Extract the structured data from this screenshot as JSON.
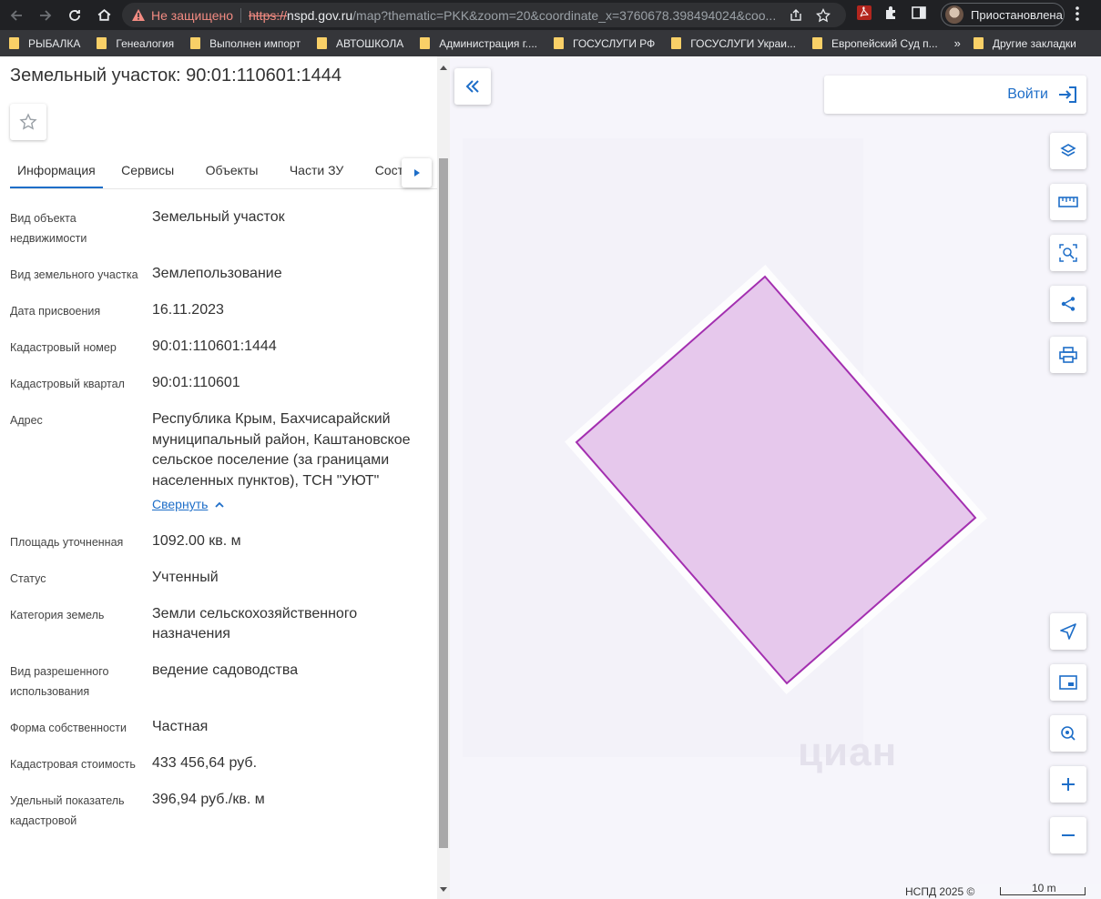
{
  "browser": {
    "security_label": "Не защищено",
    "url_scheme": "https://",
    "url_host": "nspd.gov.ru",
    "url_rest": "/map?thematic=PKK&zoom=20&coordinate_x=3760678.398494024&coo...",
    "profile_label": "Приостановлена"
  },
  "bookmarks": {
    "items": [
      "РЫБАЛКА",
      "Генеалогия",
      "Выполнен импорт",
      "АВТОШКОЛА",
      "Администрация г....",
      "ГОСУСЛУГИ РФ",
      "ГОСУСЛУГИ Украи...",
      "Европейский Суд п..."
    ],
    "more": "»",
    "other": "Другие закладки"
  },
  "panel": {
    "title": "Земельный участок: 90:01:110601:1444",
    "tabs": [
      "Информация",
      "Сервисы",
      "Объекты",
      "Части ЗУ",
      "Соста..."
    ],
    "rows": [
      {
        "label": "Вид объекта недвижимости",
        "value": "Земельный участок"
      },
      {
        "label": "Вид земельного участка",
        "value": "Землепользование"
      },
      {
        "label": "Дата присвоения",
        "value": "16.11.2023"
      },
      {
        "label": "Кадастровый номер",
        "value": "90:01:110601:1444"
      },
      {
        "label": "Кадастровый квартал",
        "value": "90:01:110601"
      },
      {
        "label": "Адрес",
        "value": "Республика Крым, Бахчисарайский муниципальный район, Каштановское сельское поселение (за границами населенных пунктов), ТСН \"УЮТ\"",
        "link": "Свернуть"
      },
      {
        "label": "Площадь уточненная",
        "value": "1092.00 кв. м"
      },
      {
        "label": "Статус",
        "value": "Учтенный"
      },
      {
        "label": "Категория земель",
        "value": "Земли сельскохозяйственного назначения"
      },
      {
        "label": "Вид разрешенного использования",
        "value": "ведение садоводства"
      },
      {
        "label": "Форма собственности",
        "value": "Частная"
      },
      {
        "label": "Кадастровая стоимость",
        "value": "433 456,64 руб."
      },
      {
        "label": "Удельный показатель кадастровой",
        "value": "396,94 руб./кв. м"
      }
    ]
  },
  "map": {
    "login_label": "Войти",
    "watermark": "циан",
    "attribution": "НСПД 2025 ©",
    "scale_label": "10 m",
    "parcel_fill": "#e6c8ec",
    "parcel_stroke": "#a32fb0",
    "accent": "#1e6ec8"
  }
}
